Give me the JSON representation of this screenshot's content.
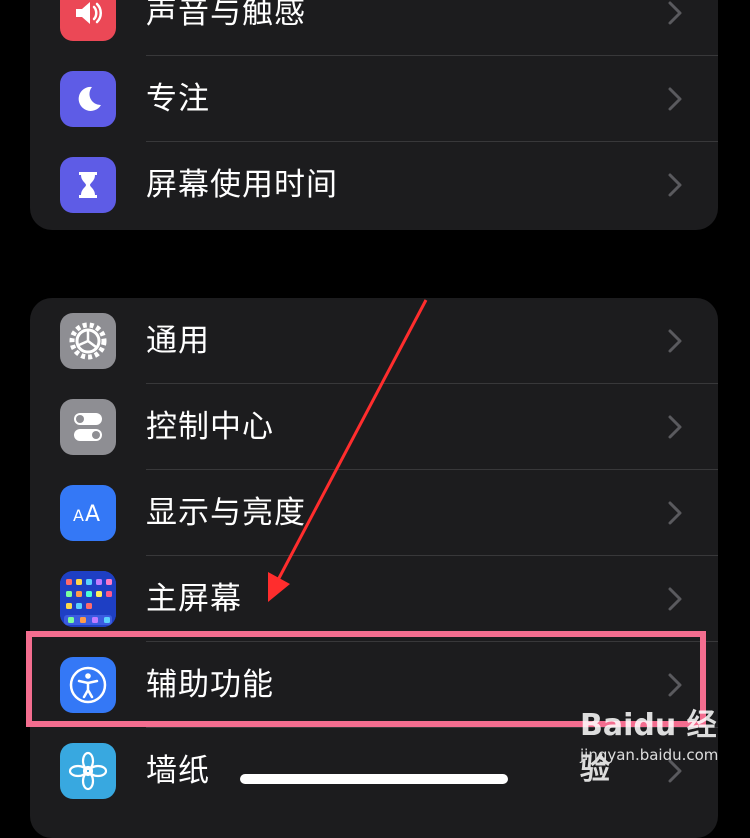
{
  "group1": {
    "items": [
      {
        "label": "声音与触感",
        "icon": "speaker-icon",
        "color": "#eb4856"
      },
      {
        "label": "专注",
        "icon": "moon-icon",
        "color": "#5e5ce6"
      },
      {
        "label": "屏幕使用时间",
        "icon": "hourglass-icon",
        "color": "#5e5ce6"
      }
    ]
  },
  "group2": {
    "items": [
      {
        "label": "通用",
        "icon": "gear-icon",
        "color": "#8e8e93"
      },
      {
        "label": "控制中心",
        "icon": "toggle-icon",
        "color": "#8e8e93"
      },
      {
        "label": "显示与亮度",
        "icon": "text-size-icon",
        "color": "#3478f6"
      },
      {
        "label": "主屏幕",
        "icon": "home-screen-icon",
        "color": "#3478f6"
      },
      {
        "label": "辅助功能",
        "icon": "accessibility-icon",
        "color": "#3478f6"
      },
      {
        "label": "墙纸",
        "icon": "flower-icon",
        "color": "#38a8e0"
      }
    ]
  },
  "annotation": {
    "highlight_color": "#f36d8f",
    "arrow_color": "#ff2d2d"
  },
  "watermark": {
    "brand": "Baidu 经验",
    "url": "jingyan.baidu.com"
  }
}
